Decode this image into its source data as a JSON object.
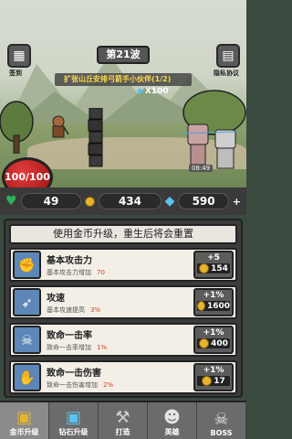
{
  "top": {
    "left_button_label": "签到",
    "right_button_label": "隐私协议",
    "wave_label": "第21波"
  },
  "quest": {
    "text": "扩张山丘安排弓箭手小伙伴(1/2)",
    "reward": "X100"
  },
  "player": {
    "hp_text": "100/100"
  },
  "resources": {
    "lives": "49",
    "gold": "434",
    "diamonds": "590"
  },
  "panel": {
    "header": "使用金币升级，重生后将会重置",
    "rows": [
      {
        "title": "基本攻击力",
        "desc": "基本攻击力增加",
        "pct": "70",
        "plus": "+5",
        "cost": "154",
        "icon": "fist-icon"
      },
      {
        "title": "攻速",
        "desc": "基本攻速提高",
        "pct": "3%",
        "plus": "+1%",
        "cost": "1600",
        "icon": "arrow-icon"
      },
      {
        "title": "致命一击率",
        "desc": "致命一击率增加",
        "pct": "1%",
        "plus": "+1%",
        "cost": "400",
        "icon": "bite-icon"
      },
      {
        "title": "致命一击伤害",
        "desc": "致命一击伤害增加",
        "pct": "2%",
        "plus": "+1%",
        "cost": "17",
        "icon": "claw-icon"
      }
    ]
  },
  "nav": [
    {
      "label": "金币升级",
      "icon": "coin-chest-icon"
    },
    {
      "label": "钻石升级",
      "icon": "gem-chest-icon"
    },
    {
      "label": "打造",
      "icon": "anvil-icon"
    },
    {
      "label": "英雄",
      "icon": "hero-icon"
    },
    {
      "label": "BOSS",
      "icon": "skull-icon"
    }
  ]
}
